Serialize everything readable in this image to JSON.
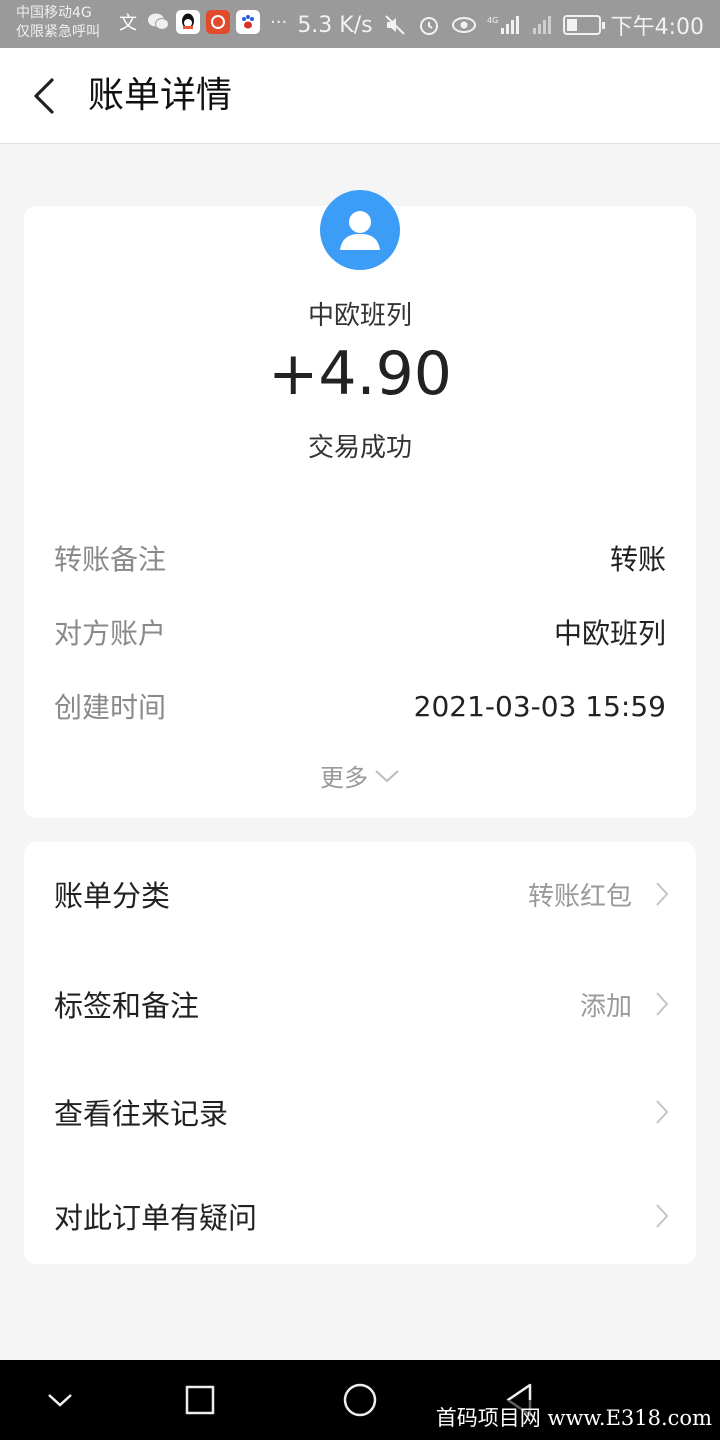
{
  "status_bar": {
    "carrier_line1": "中国移动4G",
    "carrier_line2": "仅限紧急呼叫",
    "app_icons": [
      "translate-icon",
      "wechat-icon",
      "qq-icon",
      "app-icon",
      "baidu-icon"
    ],
    "more": "···",
    "network_speed": "5.3 K/s",
    "time": "下午4:00"
  },
  "header": {
    "title": "账单详情"
  },
  "transaction": {
    "payee": "中欧班列",
    "amount": "+4.90",
    "status": "交易成功",
    "details": [
      {
        "label": "转账备注",
        "value": "转账"
      },
      {
        "label": "对方账户",
        "value": "中欧班列"
      },
      {
        "label": "创建时间",
        "value": "2021-03-03 15:59"
      }
    ],
    "more_label": "更多"
  },
  "options": [
    {
      "label": "账单分类",
      "value": "转账红包"
    },
    {
      "label": "标签和备注",
      "value": "添加"
    },
    {
      "label": "查看往来记录",
      "value": ""
    },
    {
      "label": "对此订单有疑问",
      "value": ""
    }
  ],
  "watermark": "首码项目网 www.E318.com",
  "colors": {
    "avatar_bg": "#3b9df5",
    "page_bg": "#f5f5f5",
    "status_bar_bg": "#9a9a9a"
  }
}
